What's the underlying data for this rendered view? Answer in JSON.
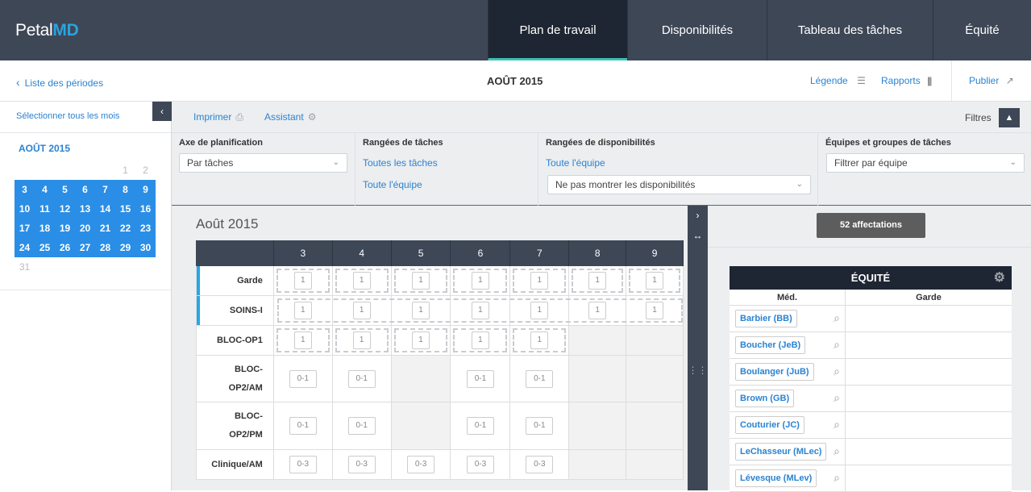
{
  "app": {
    "logo_main": "Petal",
    "logo_accent": "MD"
  },
  "nav": {
    "tabs": [
      {
        "label": "Plan de travail",
        "active": true
      },
      {
        "label": "Disponibilités",
        "active": false
      },
      {
        "label": "Tableau des tâches",
        "active": false
      },
      {
        "label": "Équité",
        "active": false
      }
    ]
  },
  "subbar": {
    "back_label": "Liste des périodes",
    "month_title": "AOÛT 2015",
    "legend_label": "Légende",
    "reports_label": "Rapports",
    "publish_label": "Publier"
  },
  "sidebar": {
    "select_all": "Sélectionner tous les mois",
    "calendar_title": "AOÛT 2015",
    "weeks": [
      [
        {
          "d": "",
          "s": false
        },
        {
          "d": "",
          "s": false
        },
        {
          "d": "",
          "s": false
        },
        {
          "d": "",
          "s": false
        },
        {
          "d": "",
          "s": false
        },
        {
          "d": "1",
          "s": false
        },
        {
          "d": "2",
          "s": false
        }
      ],
      [
        {
          "d": "3",
          "s": true
        },
        {
          "d": "4",
          "s": true
        },
        {
          "d": "5",
          "s": true
        },
        {
          "d": "6",
          "s": true
        },
        {
          "d": "7",
          "s": true
        },
        {
          "d": "8",
          "s": true
        },
        {
          "d": "9",
          "s": true
        }
      ],
      [
        {
          "d": "10",
          "s": true
        },
        {
          "d": "11",
          "s": true
        },
        {
          "d": "12",
          "s": true
        },
        {
          "d": "13",
          "s": true
        },
        {
          "d": "14",
          "s": true
        },
        {
          "d": "15",
          "s": true
        },
        {
          "d": "16",
          "s": true
        }
      ],
      [
        {
          "d": "17",
          "s": true
        },
        {
          "d": "18",
          "s": true
        },
        {
          "d": "19",
          "s": true
        },
        {
          "d": "20",
          "s": true
        },
        {
          "d": "21",
          "s": true
        },
        {
          "d": "22",
          "s": true
        },
        {
          "d": "23",
          "s": true
        }
      ],
      [
        {
          "d": "24",
          "s": true
        },
        {
          "d": "25",
          "s": true
        },
        {
          "d": "26",
          "s": true
        },
        {
          "d": "27",
          "s": true
        },
        {
          "d": "28",
          "s": true
        },
        {
          "d": "29",
          "s": true
        },
        {
          "d": "30",
          "s": true
        }
      ],
      [
        {
          "d": "31",
          "s": false
        },
        {
          "d": "",
          "s": false
        },
        {
          "d": "",
          "s": false
        },
        {
          "d": "",
          "s": false
        },
        {
          "d": "",
          "s": false
        },
        {
          "d": "",
          "s": false
        },
        {
          "d": "",
          "s": false
        }
      ]
    ]
  },
  "toolbar": {
    "print_label": "Imprimer",
    "assistant_label": "Assistant",
    "filters_label": "Filtres"
  },
  "filters": {
    "axis": {
      "title": "Axe de planification",
      "value": "Par tâches"
    },
    "task_rows": {
      "title": "Rangées de tâches",
      "link1": "Toutes les tâches",
      "link2": "Toute l'équipe"
    },
    "avail_rows": {
      "title": "Rangées de disponibilités",
      "link1": "Toute l'équipe",
      "value": "Ne pas montrer les disponibilités"
    },
    "teams": {
      "title": "Équipes et groupes de tâches",
      "value": "Filtrer par équipe"
    }
  },
  "schedule": {
    "title": "Août 2015",
    "days": [
      "3",
      "4",
      "5",
      "6",
      "7",
      "8",
      "9"
    ],
    "rows": [
      {
        "label": "Garde",
        "marked": true,
        "cells": [
          "1",
          "1",
          "1",
          "1",
          "1",
          "1",
          "1"
        ]
      },
      {
        "label": "SOINS-I",
        "marked": true,
        "cells": [
          "1",
          "1",
          "1",
          "1",
          "1",
          "1",
          "1"
        ]
      },
      {
        "label": "BLOC-OP1",
        "marked": false,
        "cells": [
          "1",
          "1",
          "1",
          "1",
          "1",
          "",
          ""
        ]
      },
      {
        "label": "BLOC-\nOP2/AM",
        "marked": false,
        "cells": [
          "0-1",
          "0-1",
          "",
          "0-1",
          "0-1",
          "",
          ""
        ]
      },
      {
        "label": "BLOC-\nOP2/PM",
        "marked": false,
        "cells": [
          "0-1",
          "0-1",
          "",
          "0-1",
          "0-1",
          "",
          ""
        ]
      },
      {
        "label": "Clinique/AM",
        "marked": false,
        "cells": [
          "0-3",
          "0-3",
          "0-3",
          "0-3",
          "0-3",
          "",
          ""
        ]
      }
    ]
  },
  "right_panel": {
    "affectations": "52 affectations",
    "equity_title": "ÉQUITÉ",
    "col_med": "Méd.",
    "col_garde": "Garde",
    "doctors": [
      "Barbier (BB)",
      "Boucher (JeB)",
      "Boulanger (JuB)",
      "Brown (GB)",
      "Couturier (JC)",
      "LeChasseur (MLec)",
      "Lévesque (MLev)"
    ]
  }
}
